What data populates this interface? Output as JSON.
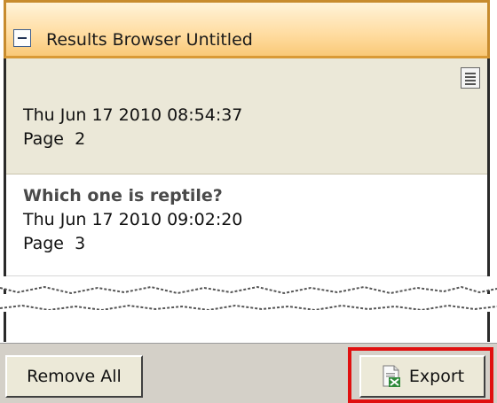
{
  "panel": {
    "title": "Results Browser Untitled",
    "collapse_icon": "minus-box-icon"
  },
  "results": [
    {
      "title": "",
      "timestamp": "Thu Jun 17 2010 08:54:37",
      "page": "Page  2",
      "note_icon": "notes-icon"
    },
    {
      "title": "Which one is reptile?",
      "timestamp": "Thu Jun 17 2010 09:02:20",
      "page": "Page  3"
    }
  ],
  "footer": {
    "remove_all_label": "Remove All",
    "export_label": "Export",
    "export_icon": "excel-export-icon",
    "highlight_color": "#e01010"
  }
}
